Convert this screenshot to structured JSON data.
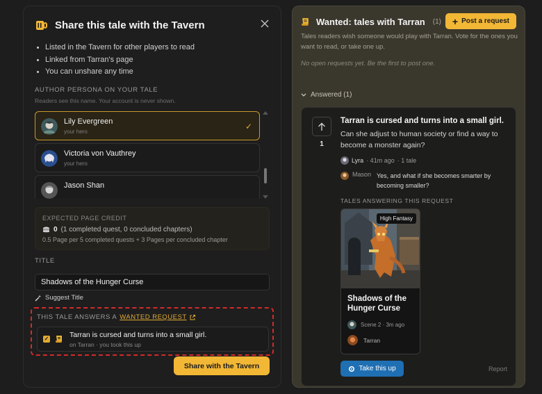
{
  "modal": {
    "title": "Share this tale with the Tavern",
    "bullets": [
      "Listed in the Tavern for other players to read",
      "Linked from Tarran's page",
      "You can unshare any time"
    ],
    "persona_label": "AUTHOR PERSONA ON YOUR TALE",
    "persona_sub": "Readers see this name. Your account is never shown.",
    "personas": [
      {
        "name": "Lily Evergreen",
        "role": "your hero",
        "selected": true
      },
      {
        "name": "Victoria von Vauthrey",
        "role": "your hero",
        "selected": false
      },
      {
        "name": "Jason Shan",
        "role": "",
        "selected": false
      }
    ],
    "credit": {
      "label": "EXPECTED PAGE CREDIT",
      "value": "0",
      "value_detail": "(1 completed quest, 0 concluded chapters)",
      "formula": "0.5 Page per 5 completed quests + 3 Pages per concluded chapter"
    },
    "title_label": "TITLE",
    "title_value": "Shadows of the Hunger Curse",
    "suggest_label": "Suggest Title",
    "answers_label": "THIS TALE ANSWERS A",
    "answers_link": "WANTED REQUEST",
    "answer_item": {
      "title": "Tarran is cursed and turns into a small girl.",
      "meta": "on Tarran · you took this up",
      "checked": true
    },
    "share_label": "Share with the Tavern"
  },
  "wanted": {
    "title": "Wanted: tales with Tarran",
    "count": "(1)",
    "post_label": "Post a request",
    "desc": "Tales readers wish someone would play with Tarran. Vote for the ones you want to read, or take one up.",
    "empty": "No open requests yet. Be the first to post one.",
    "answered_label": "Answered (1)",
    "request": {
      "votes": "1",
      "title": "Tarran is cursed and turns into a small girl.",
      "body": "Can she adjust to human society or find a way to become a monster again?",
      "author": "Lyra",
      "time": "· 41m ago",
      "tales": "· 1 tale",
      "reply_author": "Mason",
      "reply_text": "Yes, and what if she becomes smarter by becoming smaller?",
      "tales_label": "TALES ANSWERING THIS REQUEST",
      "tale": {
        "genre": "High Fantasy",
        "title": "Shadows of the Hunger Curse",
        "meta": "Scene 2 · 3m ago",
        "author": "Tarran"
      },
      "take_label": "Take this up",
      "report_label": "Report"
    }
  },
  "colors": {
    "accent": "#f2b735",
    "link_blue": "#1f6fb3",
    "highlight_border": "#d32b2b"
  }
}
